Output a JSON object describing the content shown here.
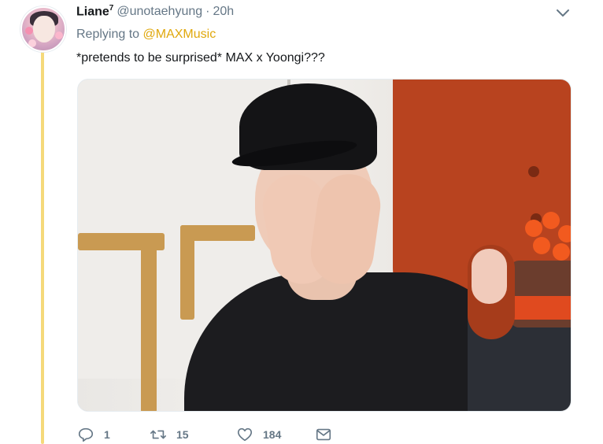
{
  "tweet": {
    "display_name": "Liane",
    "name_superscript": "7",
    "handle": "@unotaehyung",
    "separator": "·",
    "time": "20h",
    "replying_prefix": "Replying to",
    "replying_to": "@MAXMusic",
    "text": "*pretends to be surprised* MAX x Yoongi???"
  },
  "actions": {
    "reply_count": "1",
    "retweet_count": "15",
    "like_count": "184"
  },
  "icons": {
    "reply": "reply-icon",
    "retweet": "retweet-icon",
    "like": "heart-icon",
    "dm": "envelope-icon",
    "more": "chevron-down-icon"
  },
  "colors": {
    "link": "#e0a80c",
    "thread_line": "#f5d97a",
    "muted": "#657786",
    "text": "#14171a"
  }
}
